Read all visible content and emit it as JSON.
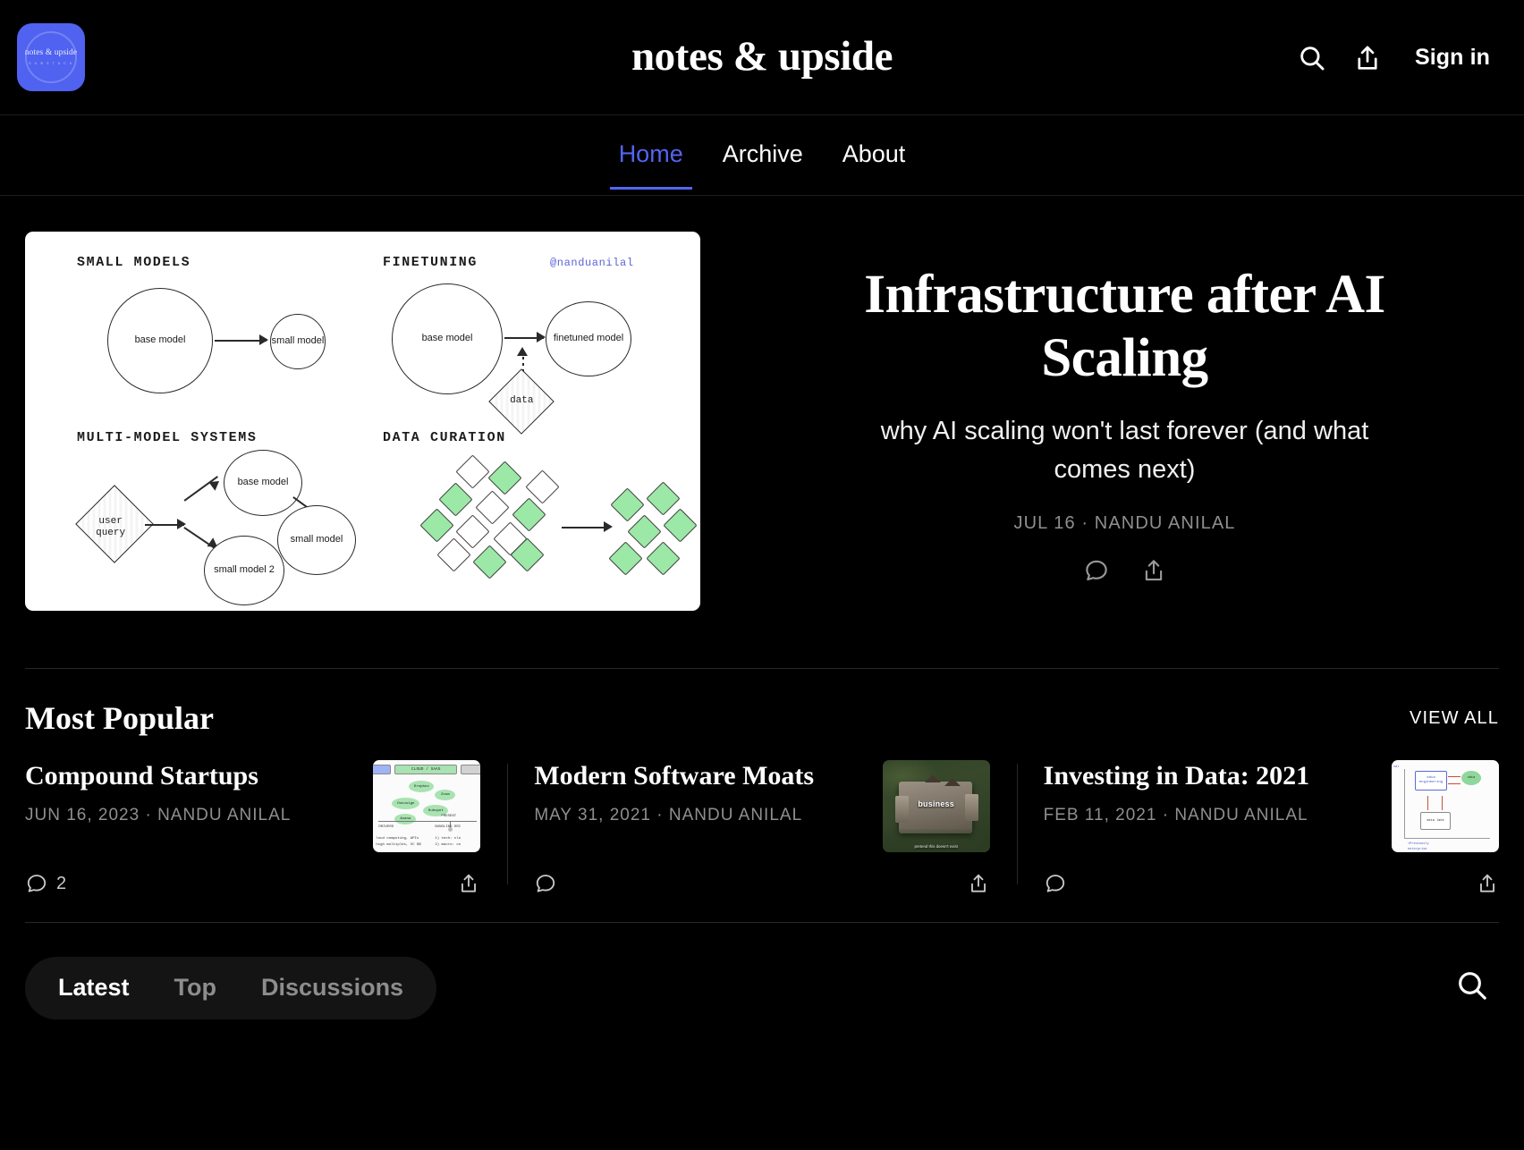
{
  "header": {
    "site_title": "notes & upside",
    "logo_text": "notes & upside",
    "logo_sub": "S U B S T A C K",
    "signin_label": "Sign in",
    "search_icon": "search-icon",
    "share_icon": "share-icon"
  },
  "nav": {
    "items": [
      {
        "label": "Home",
        "active": true
      },
      {
        "label": "Archive",
        "active": false
      },
      {
        "label": "About",
        "active": false
      }
    ]
  },
  "hero": {
    "title": "Infrastructure after AI Scaling",
    "subtitle": "why AI scaling won't last forever (and what comes next)",
    "meta": "JUL 16 · NANDU ANILAL",
    "comment_icon": "comment-icon",
    "share_icon": "share-icon",
    "diagram": {
      "handle": "@nanduanilal",
      "sections": [
        {
          "heading": "SMALL MODELS"
        },
        {
          "heading": "FINETUNING"
        },
        {
          "heading": "MULTI-MODEL SYSTEMS"
        },
        {
          "heading": "DATA CURATION"
        }
      ],
      "nodes": {
        "base_model_1": "base model",
        "small_model_1": "small model",
        "base_model_2": "base model",
        "finetuned_model": "finetuned model",
        "data": "data",
        "user_query": "user query",
        "base_model_3": "base model",
        "small_model_2": "small model",
        "small_model_3": "small model 2"
      }
    }
  },
  "most_popular": {
    "title": "Most Popular",
    "view_all_label": "VIEW ALL",
    "cards": [
      {
        "title": "Compound Startups",
        "meta": "JUN 16, 2023 · NANDU ANILAL",
        "comment_count": "2",
        "comment_icon": "comment-icon",
        "share_icon": "share-icon",
        "thumb": {
          "bar_left": "",
          "bar_mid": "CLOUD / SAAS",
          "bar_right": "",
          "nodes": [
            "Dropbox",
            "Zoom",
            "Docusign",
            "Hubspot",
            "Asana"
          ],
          "present_label": "PRESENT",
          "drivers_label": "DRIVERS",
          "bundling_label": "BUNDLING DRI",
          "note_left_1": "loud computing, APIs",
          "note_left_2": "high multiples, VC $$",
          "note_right_1": "1) tech: clo",
          "note_right_2": "2) macro: co"
        }
      },
      {
        "title": "Modern Software Moats",
        "meta": "MAY 31, 2021 · NANDU ANILAL",
        "comment_count": "",
        "comment_icon": "comment-icon",
        "share_icon": "share-icon",
        "thumb": {
          "caption": "business",
          "caption_sub": "pretend this doesn't exist"
        }
      },
      {
        "title": "Investing in Data: 2021",
        "meta": "FEB 11, 2021 · NANDU ANILAL",
        "comment_count": "",
        "comment_icon": "comment-icon",
        "share_icon": "share-icon",
        "thumb": {
          "axis_label": "val",
          "box_label": "data engineering",
          "blob_label": "data",
          "bottom_box_label": "data lake",
          "note_1": "<Previously",
          "note_2": "enterprise"
        }
      }
    ]
  },
  "feed_filters": {
    "items": [
      {
        "label": "Latest",
        "active": true
      },
      {
        "label": "Top",
        "active": false
      },
      {
        "label": "Discussions",
        "active": false
      }
    ],
    "search_icon": "search-icon"
  },
  "colors": {
    "accent": "#5365ef",
    "background": "#000000",
    "muted_text": "#8f8f8f",
    "diagram_green": "#9ce8a6"
  }
}
